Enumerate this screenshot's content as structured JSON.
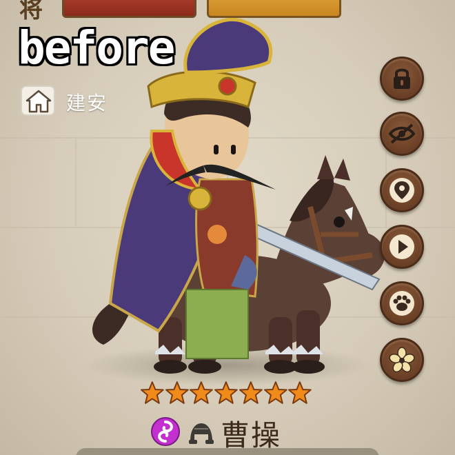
{
  "overlay": {
    "label": "before"
  },
  "top_bar": {
    "partial_glyph": "将"
  },
  "location": {
    "icon": "home-icon",
    "city": "建安"
  },
  "side_buttons": [
    {
      "id": "lock",
      "icon": "lock-icon"
    },
    {
      "id": "hide",
      "icon": "eye-off-icon"
    },
    {
      "id": "location",
      "icon": "map-pin-icon"
    },
    {
      "id": "play",
      "icon": "play-icon"
    },
    {
      "id": "pet",
      "icon": "paw-icon"
    },
    {
      "id": "flower",
      "icon": "flower-icon"
    }
  ],
  "hero": {
    "name": "曹操",
    "stars": 7,
    "faction_icon": "swirl-faction-icon",
    "class_icon": "helmet-icon"
  },
  "colors": {
    "star": "#f08a1a",
    "button_brown": "#6e4328",
    "faction_purple": "#c42fd0",
    "cape_purple": "#4b3a7a",
    "hat_gold": "#d9b43a"
  }
}
